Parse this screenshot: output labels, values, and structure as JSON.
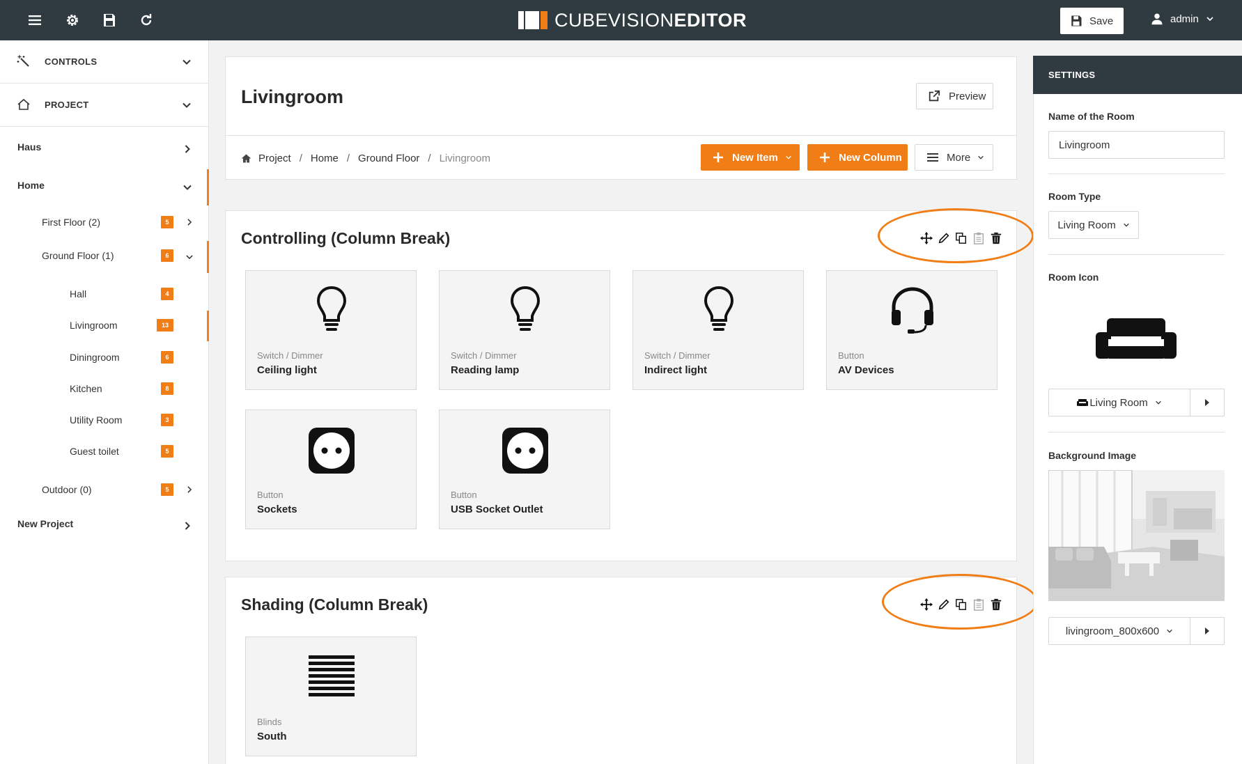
{
  "app": {
    "logo_light": "CUBEVISION",
    "logo_bold": "EDITOR",
    "save_label": "Save",
    "user_label": "admin"
  },
  "sidebar": {
    "controls_label": "CONTROLS",
    "project_label": "PROJECT",
    "tree": {
      "haus": "Haus",
      "home": "Home",
      "first_floor": {
        "label": "First Floor (2)",
        "badge": "5"
      },
      "ground_floor": {
        "label": "Ground Floor (1)",
        "badge": "6"
      },
      "rooms": [
        {
          "label": "Hall",
          "badge": "4"
        },
        {
          "label": "Livingroom",
          "badge": "13"
        },
        {
          "label": "Diningroom",
          "badge": "6"
        },
        {
          "label": "Kitchen",
          "badge": "8"
        },
        {
          "label": "Utility Room",
          "badge": "3"
        },
        {
          "label": "Guest toilet",
          "badge": "5"
        }
      ],
      "outdoor": {
        "label": "Outdoor (0)",
        "badge": "5"
      },
      "new_project": "New Project"
    }
  },
  "main": {
    "title": "Livingroom",
    "preview_label": "Preview",
    "breadcrumb": [
      "Project",
      "Home",
      "Ground Floor",
      "Livingroom"
    ],
    "new_item_label": "New Item",
    "new_column_label": "New Column",
    "more_label": "More",
    "sections": [
      {
        "title": "Controlling (Column Break)",
        "tiles": [
          {
            "type": "Switch / Dimmer",
            "name": "Ceiling light",
            "icon": "lightbulb-icon"
          },
          {
            "type": "Switch / Dimmer",
            "name": "Reading lamp",
            "icon": "lightbulb-icon"
          },
          {
            "type": "Switch / Dimmer",
            "name": "Indirect light",
            "icon": "lightbulb-icon"
          },
          {
            "type": "Button",
            "name": "AV Devices",
            "icon": "headset-icon"
          },
          {
            "type": "Button",
            "name": "Sockets",
            "icon": "socket-icon"
          },
          {
            "type": "Button",
            "name": "USB Socket Outlet",
            "icon": "socket-icon"
          }
        ]
      },
      {
        "title": "Shading (Column Break)",
        "tiles": [
          {
            "type": "Blinds",
            "name": "South",
            "icon": "blinds-icon"
          }
        ]
      }
    ]
  },
  "settings": {
    "header": "SETTINGS",
    "room_name_label": "Name of the Room",
    "room_name_value": "Livingroom",
    "room_type_label": "Room Type",
    "room_type_value": "Living Room",
    "room_icon_label": "Room Icon",
    "room_icon_value": "Living Room",
    "bg_image_label": "Background Image",
    "bg_image_value": "livingroom_800x600"
  },
  "colors": {
    "accent": "#f07d15",
    "topbar": "#2f3a41"
  }
}
